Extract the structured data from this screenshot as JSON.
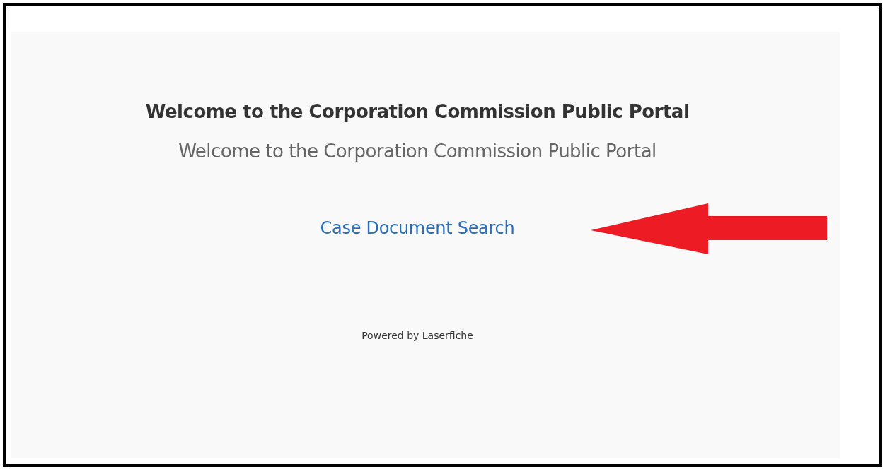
{
  "portal": {
    "title": "Welcome to the Corporation Commission Public Portal",
    "subtitle": "Welcome to the Corporation Commission Public Portal",
    "links": [
      "Case Document Search"
    ],
    "footer": "Powered by Laserfiche"
  }
}
